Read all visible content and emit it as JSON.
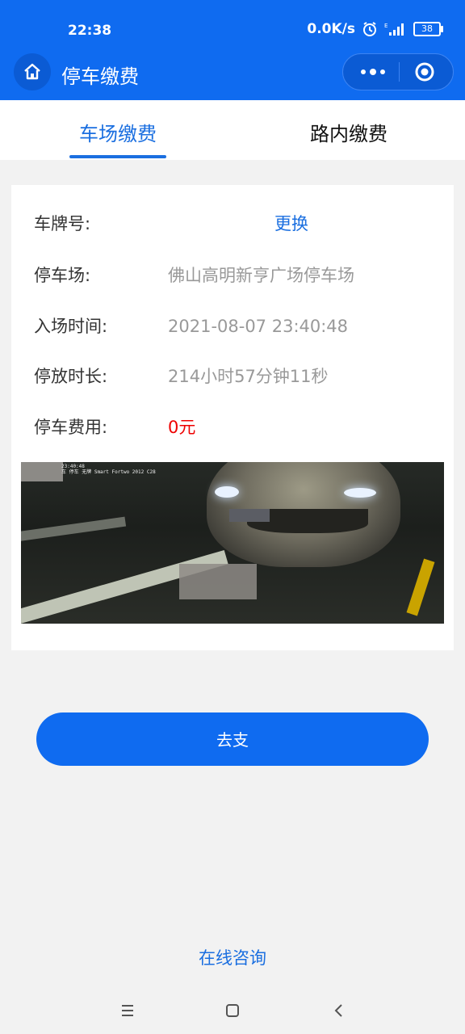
{
  "status_bar": {
    "time": "22:38",
    "net_speed": "0.0K/s",
    "battery": "38",
    "icons": [
      "alarm-icon",
      "signal-icon",
      "battery-icon"
    ]
  },
  "nav": {
    "title": "停车缴费",
    "icons": [
      "home-icon",
      "more-icon",
      "close-target-icon"
    ]
  },
  "tabs": [
    {
      "label": "车场缴费",
      "active": true
    },
    {
      "label": "路内缴费",
      "active": false
    }
  ],
  "info": {
    "plate": {
      "label": "车牌号:",
      "value": "更换"
    },
    "lot": {
      "label": "停车场:",
      "value": "佛山高明新亨广场停车场"
    },
    "entry_time": {
      "label": "入场时间:",
      "value": "2021-08-07 23:40:48"
    },
    "duration": {
      "label": "停放时长:",
      "value": "214小时57分钟11秒"
    },
    "fee": {
      "label": "停车费用:",
      "value": "0元"
    }
  },
  "photo_stamp": "23:40:48\n车 停车 无牌 Smart Fortwo 2012 C28",
  "pay_button": "去支",
  "consult_link": "在线咨询",
  "colors": {
    "brand": "#0f6bf0",
    "link": "#1b6fe0",
    "fee": "#e00000",
    "background": "#f2f2f2"
  }
}
